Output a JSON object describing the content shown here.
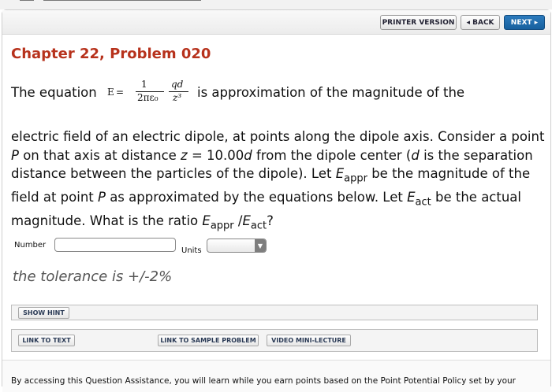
{
  "nav": {
    "printer_label": "PRINTER VERSION",
    "back_label": "◂ BACK",
    "next_label": "NEXT ▸"
  },
  "problem": {
    "title": "Chapter 22, Problem 020",
    "intro": "The equation",
    "equation": {
      "lhs": "E",
      "equals": "=",
      "frac1_num": "1",
      "frac1_den": "2πε₀",
      "frac2_num": "qd",
      "frac2_den": "z³"
    },
    "intro_after": "is approximation of the magnitude of the",
    "body_text": "electric field of an electric dipole, at points along the dipole axis. Consider a point P on that axis at distance z = 10.00d from the dipole center (d is the separation distance between the particles of the dipole). Let Eappr be the magnitude of the field at point P as approximated by the equations below. Let Eact be the actual magnitude. What is the ratio Eappr /Eact?",
    "p2": {
      "a": "electric field of an electric dipole, at points along the dipole axis. Consider a point ",
      "P": "P",
      "b": " on that axis at distance ",
      "z": "z",
      "c": " = 10.00",
      "d1": "d",
      "e": " from the dipole center (",
      "d2": "d",
      "f": " is the separation distance between the particles of the dipole). Let ",
      "E1": "E",
      "appr1": "appr",
      "g": " be the magnitude of the field at point ",
      "P2": "P",
      "h": " as approximated by the equations below. Let ",
      "E2": "E",
      "act1": "act",
      "i": " be the actual magnitude. What is the ratio ",
      "E3": "E",
      "appr2": "appr",
      "j": " /",
      "E4": "E",
      "act2": "act",
      "k": "?"
    }
  },
  "answer": {
    "number_label": "Number",
    "number_value": "",
    "units_label": "Units",
    "units_selected": ""
  },
  "tolerance": "the tolerance is +/-2%",
  "buttons": {
    "show_hint": "SHOW HINT",
    "link_to_text": "LINK TO TEXT",
    "link_to_sample": "LINK TO SAMPLE PROBLEM",
    "video_lecture": "VIDEO MINI-LECTURE"
  },
  "footer": "By accessing this Question Assistance, you will learn while you earn points based on the Point Potential Policy set by your"
}
